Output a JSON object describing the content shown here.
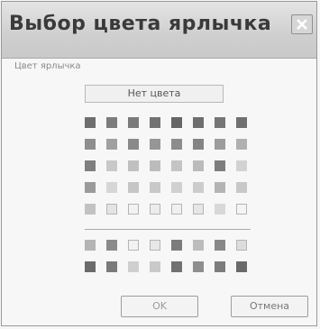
{
  "dialog": {
    "title": "Выбор цвета ярлычка",
    "field_label": "Цвет ярлычка",
    "no_color_label": "Нет цвета",
    "ok_label": "OK",
    "cancel_label": "Отмена"
  },
  "palette": {
    "main_rows": [
      [
        "#6e6e6e",
        "#7c7c7c",
        "#7a7a7a",
        "#727272",
        "#666666",
        "#6e6e6e",
        "#757575",
        "#707070"
      ],
      [
        "#8e8e8e",
        "#a0a0a0",
        "#8a8a8a",
        "#969696",
        "#8c8c8c",
        "#848484",
        "#9c9c9c",
        "#b0b0b0"
      ],
      [
        "#7f7f7f",
        "#c8c8c8",
        "#c0c0c0",
        "#bcbcbc",
        "#c4c4c4",
        "#bbbbbb",
        "#7e7e7e",
        "#d2d2d2"
      ],
      [
        "#9a9a9a",
        "#d6d6d6",
        "#c6c6c6",
        "#c8c8c8",
        "#d0d0d0",
        "#cccccc",
        "#b4b4b4",
        "#c8c8c8"
      ],
      [
        "#c2c2c2",
        "#e4e4e4",
        "#f2f2f2",
        "#ececec",
        "#f0f0f0",
        "#e6e6e6",
        "#d8d8d8",
        "#f4f4f4"
      ]
    ],
    "recent_rows": [
      [
        "#b4b4b4",
        "#8a8a8a",
        "#f2f2f2",
        "#e8e8e8",
        "#7c7c7c",
        "#bcbcbc",
        "#888888",
        "#dcdcdc"
      ],
      [
        "#6a6a6a",
        "#7a7a7a",
        "#cfcfcf",
        "#c9c9c9",
        "#727272",
        "#8e8e8e",
        "#7c7c7c",
        "#6a6a6a"
      ]
    ]
  }
}
